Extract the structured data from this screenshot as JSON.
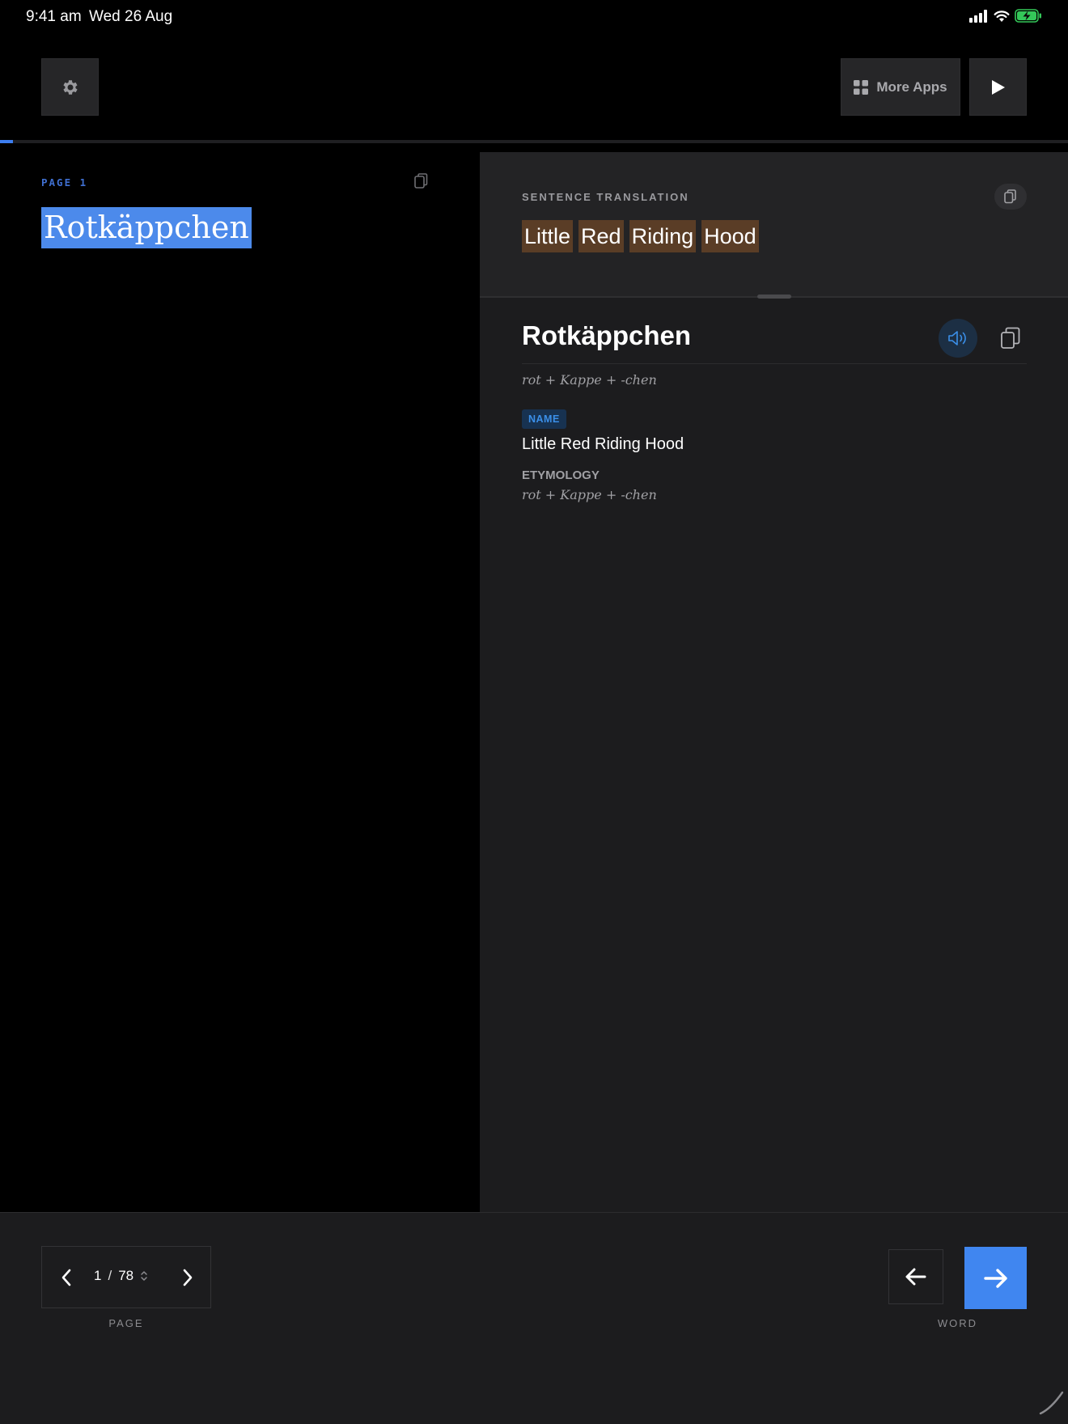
{
  "status_bar": {
    "time": "9:41 am",
    "date": "Wed 26 Aug",
    "icons": [
      "cellular-signal-icon",
      "wifi-icon",
      "battery-charging-icon"
    ]
  },
  "toolbar": {
    "settings_icon": "gear-icon",
    "more_apps_label": "More Apps",
    "more_apps_icon": "grid-icon",
    "play_icon": "play-icon"
  },
  "reading_progress": 0.012,
  "reader": {
    "page_label": "PAGE 1",
    "title": "Rotkäppchen",
    "copy_icon": "copy-icon"
  },
  "translation": {
    "section_label": "SENTENCE TRANSLATION",
    "tokens": [
      "Little",
      "Red",
      "Riding",
      "Hood"
    ],
    "copy_icon": "copy-icon"
  },
  "word_detail": {
    "word": "Rotkäppchen",
    "breakdown": "rot + Kappe + -chen",
    "part_of_speech": "NAME",
    "definition": "Little Red Riding Hood",
    "etymology_label": "ETYMOLOGY",
    "etymology": "rot + Kappe + -chen",
    "speaker_icon": "speaker-icon",
    "copy_icon": "copy-icon"
  },
  "bottom": {
    "page_current": "1",
    "page_separator": "/",
    "page_total": "78",
    "page_caption": "PAGE",
    "word_caption": "WORD"
  },
  "colors": {
    "accent": "#4086f0",
    "highlight": "#4c8aeb",
    "token_bg": "#5a3d26",
    "badge_text": "#3b8fe8",
    "panel_bg": "#1c1c1e"
  }
}
